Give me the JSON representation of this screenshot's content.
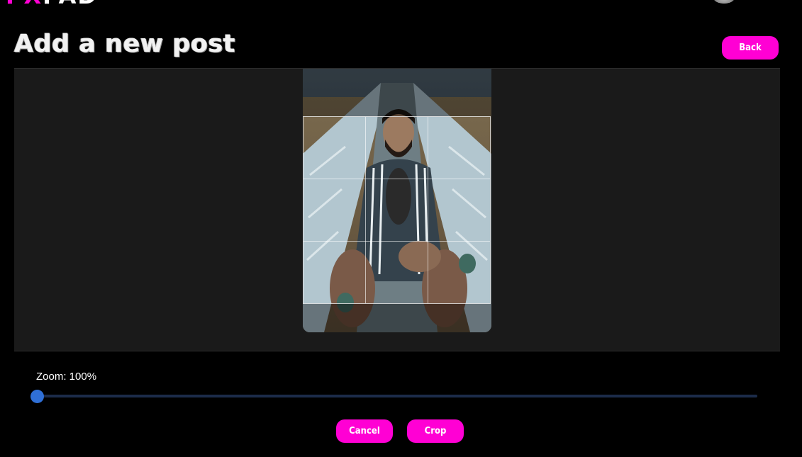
{
  "header": {
    "logo_part1": "PX",
    "logo_part2": "PAD"
  },
  "page": {
    "title": "Add a new post",
    "back_label": "Back"
  },
  "cropper": {
    "zoom_label": "Zoom: 100%",
    "zoom_fraction": 0.0
  },
  "actions": {
    "cancel_label": "Cancel",
    "crop_label": "Crop"
  },
  "colors": {
    "accent": "#ff00d4",
    "slider_thumb": "#2f6fd6",
    "slider_track": "#1c2c4a",
    "crop_background": "#1a1a1a"
  }
}
